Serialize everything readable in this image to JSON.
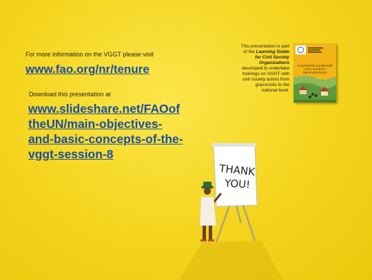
{
  "info": {
    "label": "For more information on the VGGT please visit",
    "link": "www.fao.org/nr/tenure"
  },
  "download": {
    "label": "Download this presentation at",
    "link_lines": [
      "www.slideshare.net/FAOof",
      "theUN/main-objectives-",
      "and-basic-concepts-of-the-",
      "vggt-session-8"
    ]
  },
  "note": {
    "before": "This presentation is part of the ",
    "title": "Learning Guide for Civil Society Organizations",
    "after": " developed to undertake trainings on VGGT with civil society actors from grassroots to the national level."
  },
  "book": {
    "title": "A LEARNING GUIDE FOR CIVIL SOCIETY ORGANIZATIONS"
  },
  "flipchart": {
    "line1": "THANK",
    "line2": "YOU!"
  },
  "colors": {
    "background": "#f4d41c",
    "link": "#1a4fa3",
    "book_cover": "#f2b416"
  }
}
